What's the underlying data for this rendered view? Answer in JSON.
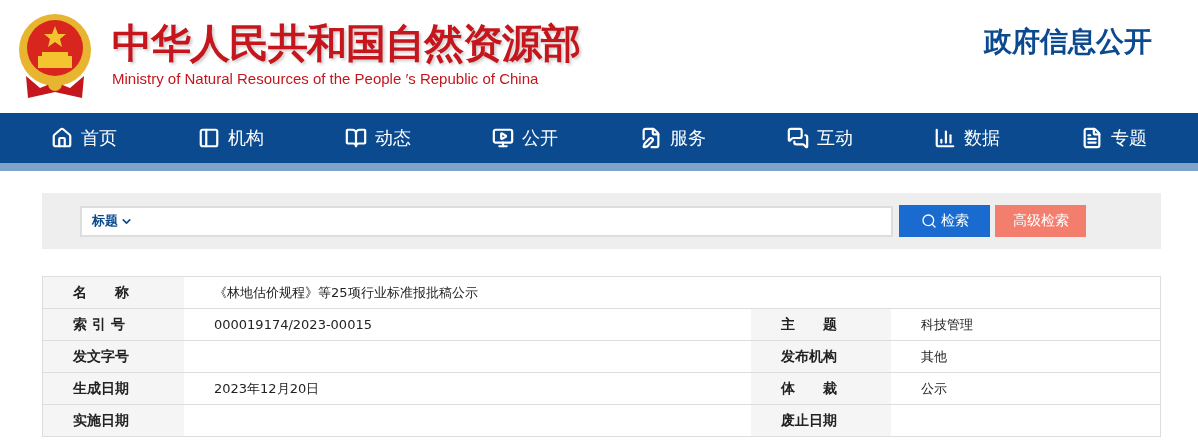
{
  "header": {
    "title": "中华人民共和国自然资源部",
    "subtitle": "Ministry of Natural Resources of the People ′s Republic of China",
    "section": "政府信息公开"
  },
  "nav": [
    {
      "label": "首页"
    },
    {
      "label": "机构"
    },
    {
      "label": "动态"
    },
    {
      "label": "公开"
    },
    {
      "label": "服务"
    },
    {
      "label": "互动"
    },
    {
      "label": "数据"
    },
    {
      "label": "专题"
    }
  ],
  "search": {
    "scope": "标题",
    "search_button": "检索",
    "advanced_button": "高级检索"
  },
  "info_table": {
    "rows": [
      {
        "fields": [
          {
            "label": "名　　称",
            "value": "《林地估价规程》等25项行业标准报批稿公示"
          }
        ]
      },
      {
        "fields": [
          {
            "label": "索 引 号",
            "value": "000019174/2023-00015"
          },
          {
            "label": "主　　题",
            "value": "科技管理"
          }
        ]
      },
      {
        "fields": [
          {
            "label": "发文字号"
          },
          {
            "label": "发布机构",
            "value": "其他"
          }
        ]
      },
      {
        "fields": [
          {
            "label": "生成日期",
            "value": "2023年12月20日"
          },
          {
            "label": "体　　裁",
            "value": "公示"
          }
        ]
      },
      {
        "fields": [
          {
            "label": "实施日期"
          },
          {
            "label": "废止日期"
          }
        ]
      }
    ]
  }
}
